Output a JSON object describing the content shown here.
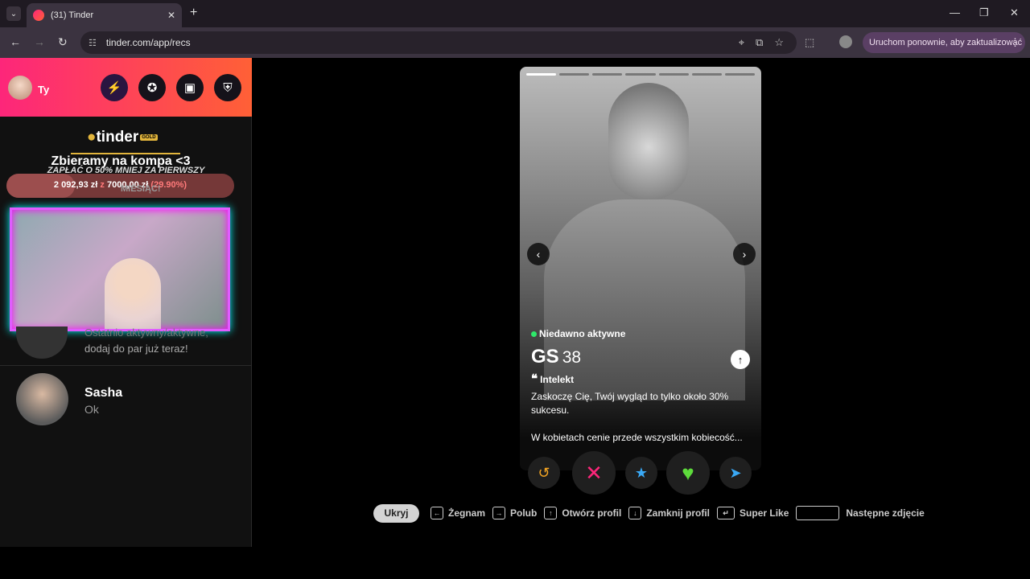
{
  "browser": {
    "tab_title": "(31) Tinder",
    "url": "tinder.com/app/recs",
    "update_label": "Uruchom ponownie, aby zaktualizować"
  },
  "sidebar": {
    "user_name": "Ty",
    "gold_logo": "tinder",
    "gold_badge": "GOLD",
    "goal_title": "Zbieramy na kompa <3",
    "promo_text": "ZAPŁAĆ O 50% MNIEJ ZA PIERWSZY",
    "promo_sub": "MIESIĄC!",
    "goal_current": "2 092,93 zł",
    "goal_z": "z",
    "goal_target": "7000,00 zł",
    "goal_percent": "(29.90%)",
    "goal_fraction": 0.299,
    "faded_line1": "Ostatnio aktywny/aktywne,",
    "faded_line2": "dodaj do par już teraz!",
    "matches": [
      {
        "name": "Sasha",
        "message": "Ok"
      }
    ]
  },
  "card": {
    "status": "Niedawno aktywne",
    "name": "GS",
    "age": "38",
    "quote_label": "Intelekt",
    "bio1": "Zaskoczę Cię, Twój wygląd to tylko około 30% sukcesu.",
    "bio2": "W kobietach cenie przede wszystkim kobiecość...",
    "photo_count": 7,
    "active_photo": 0
  },
  "shortcuts": {
    "hide": "Ukryj",
    "nope": "Żegnam",
    "like": "Polub",
    "open_profile": "Otwórz profil",
    "close_profile": "Zamknij profil",
    "super_like": "Super Like",
    "next_photo": "Następne zdjęcie"
  }
}
